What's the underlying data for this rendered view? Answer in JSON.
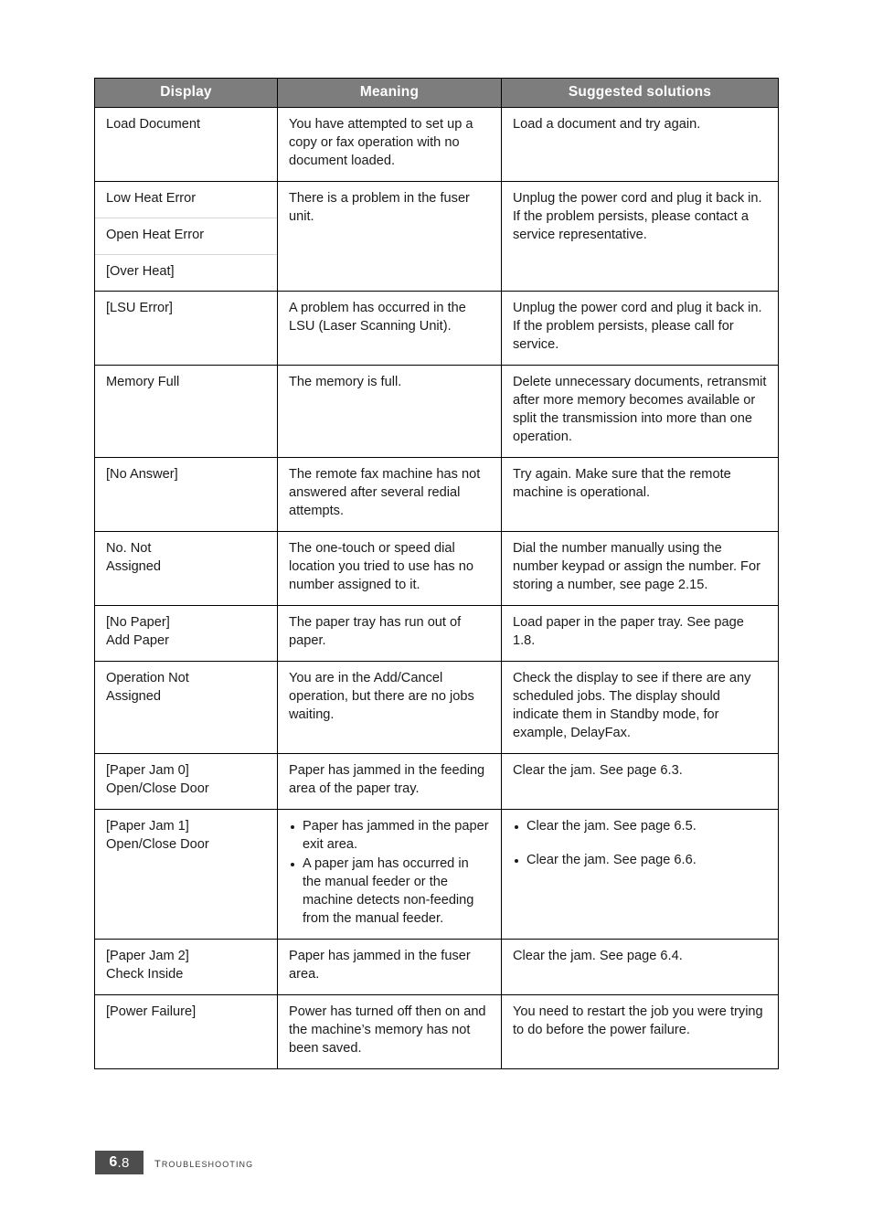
{
  "page": {
    "footer_page_major": "6",
    "footer_page_separator": ".",
    "footer_page_minor": "8",
    "footer_chapter": "Troubleshooting"
  },
  "colors": {
    "header_background": "#7d7d7d",
    "header_text": "#ffffff",
    "page_box_background": "#4d4d4d",
    "border": "#000000",
    "subdivider": "#d6d6d6"
  },
  "table": {
    "headers": {
      "display": "Display",
      "meaning": "Meaning",
      "solutions": "Suggested solutions"
    },
    "rows": [
      {
        "display": "Load Document",
        "meaning": "You have attempted to set up a copy or fax operation with no document loaded.",
        "solution": "Load a document and try again."
      },
      {
        "display_sub": [
          "Low Heat Error",
          "Open Heat Error",
          "[Over Heat]"
        ],
        "meaning": "There is a problem in the fuser unit.",
        "solution": "Unplug the power cord and plug it back in. If the problem persists, please contact a service representative."
      },
      {
        "display": "[LSU Error]",
        "meaning": "A problem has occurred in the LSU (Laser Scanning Unit).",
        "solution": "Unplug the power cord and plug it back in. If the problem persists, please call for service."
      },
      {
        "display": "Memory Full",
        "meaning": "The memory is full.",
        "solution": "Delete unnecessary documents, retransmit after more memory becomes available or split the transmission into more than one operation."
      },
      {
        "display": "[No Answer]",
        "meaning": "The remote fax machine has not answered after several redial attempts.",
        "solution": "Try again. Make sure that the remote machine is operational."
      },
      {
        "display_line1": "No. Not",
        "display_line2": "Assigned",
        "meaning": "The one-touch or speed dial location you tried to use has no number assigned to it.",
        "solution": "Dial the number manually using the number keypad or assign the number. For storing a number, see page 2.15."
      },
      {
        "display_line1": "[No Paper]",
        "display_line2": "Add Paper",
        "meaning": "The paper tray has run out of paper.",
        "solution": "Load paper in the paper tray. See page 1.8."
      },
      {
        "display_line1": "Operation Not",
        "display_line2": "Assigned",
        "meaning": "You are in the Add/Cancel operation, but there are no jobs waiting.",
        "solution": "Check the display to see if there are any scheduled jobs. The display should indicate them in Standby mode, for example, DelayFax."
      },
      {
        "display_line1": "[Paper Jam 0]",
        "display_line2": "Open/Close Door",
        "meaning": "Paper has jammed in the feeding area of the paper tray.",
        "solution": "Clear the jam. See page 6.3."
      },
      {
        "display_line1": "[Paper Jam 1]",
        "display_line2": "Open/Close Door",
        "meaning_bullets": [
          "Paper has jammed in the paper exit area.",
          "A paper jam has occurred in the manual feeder or the machine detects non-feeding from the manual feeder."
        ],
        "solution_bullets": [
          "Clear the jam. See page 6.5.",
          "Clear the jam. See page 6.6."
        ]
      },
      {
        "display_line1": "[Paper Jam 2]",
        "display_line2": "Check Inside",
        "meaning": "Paper has jammed in the fuser area.",
        "solution": "Clear the jam. See page 6.4."
      },
      {
        "display": "[Power Failure]",
        "meaning": "Power has turned off then on and the machine’s memory has not been saved.",
        "solution": "You need to restart the job you were trying to do before the power failure."
      }
    ]
  }
}
